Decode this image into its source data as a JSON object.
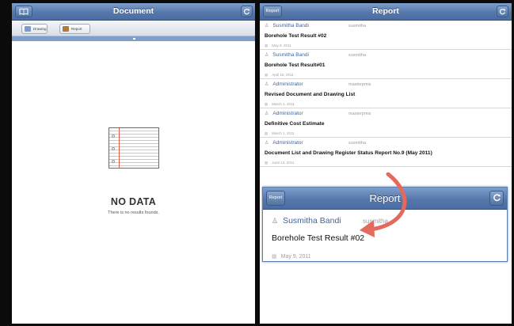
{
  "left": {
    "nav_title": "Document",
    "tabs": [
      {
        "label": "Drawing"
      },
      {
        "label": "Report"
      }
    ],
    "empty": {
      "title": "NO DATA",
      "subtitle": "There is no results founds."
    }
  },
  "right": {
    "nav_title": "Report",
    "nav_left_label": "Report",
    "reports": [
      {
        "author": "Susmitha Bandi",
        "user": "susmitha",
        "title": "Borehole Test Result #02",
        "date": "May 9, 2011"
      },
      {
        "author": "Susmitha Bandi",
        "user": "susmitha",
        "title": "Borehole Test Result#01",
        "date": "April 18, 2011"
      },
      {
        "author": "Administrator",
        "user": "masterpmis",
        "title": "Revised Document and Drawing List",
        "date": "March 1, 2011"
      },
      {
        "author": "Administrator",
        "user": "masterpmis",
        "title": "Definitive Cost Estimate",
        "date": "March 1, 2011"
      },
      {
        "author": "Administrator",
        "user": "susmitha",
        "title": "Document List and Drawing Register Status Report No.9 (May 2011)",
        "date": "June 13, 2011"
      }
    ]
  },
  "zoom": {
    "nav_title": "Report",
    "nav_left_label": "Report",
    "author": "Susmitha Bandi",
    "user": "susmitha",
    "title": "Borehole Test Result #02",
    "date": "May 9, 2011"
  },
  "icons": {
    "book": "book-icon",
    "refresh": "refresh-icon",
    "person": "person-icon",
    "calendar": "calendar-icon",
    "notebook": "notebook-icon",
    "arrow": "curved-arrow-icon"
  },
  "colors": {
    "nav_blue": "#5677ab",
    "link_blue": "#3a67a3",
    "arrow": "#e46a5d"
  }
}
